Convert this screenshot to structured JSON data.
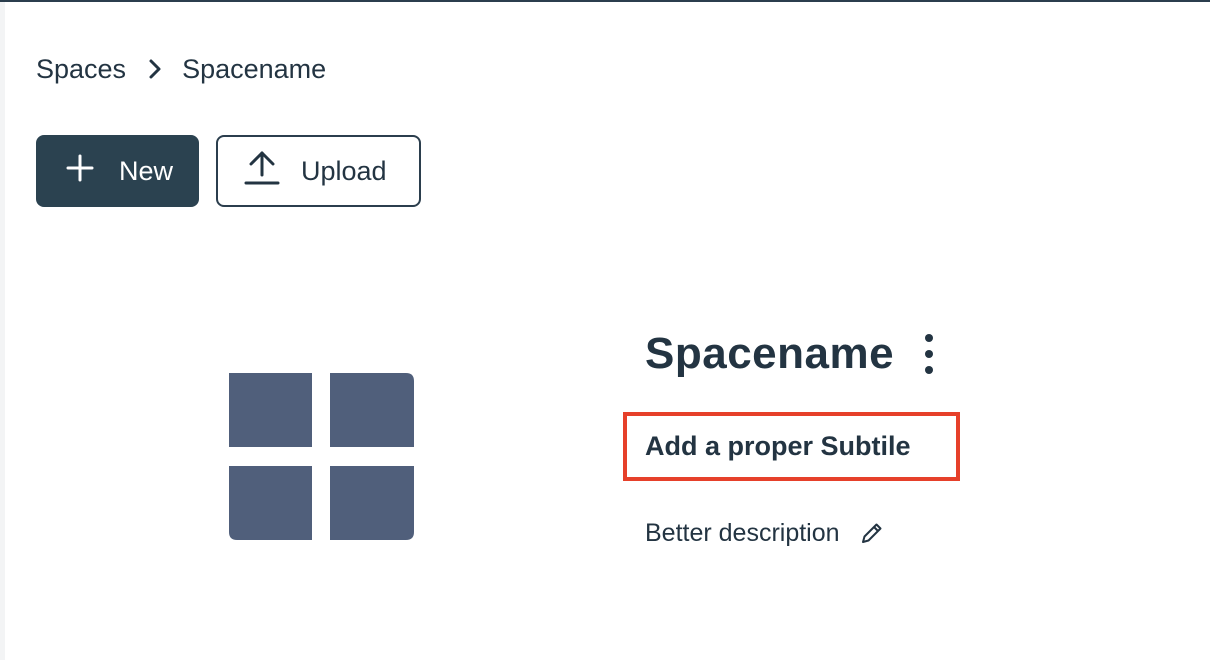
{
  "breadcrumb": {
    "items": [
      "Spaces",
      "Spacename"
    ],
    "separator_icon": "chevron-right-icon"
  },
  "toolbar": {
    "new_label": "New",
    "new_icon": "plus-icon",
    "upload_label": "Upload",
    "upload_icon": "upload-icon"
  },
  "space": {
    "icon": "space-grid-icon",
    "icon_color": "#505f7b",
    "title": "Spacename",
    "menu_icon": "kebab-menu-icon",
    "subtitle": "Add a proper Subtile",
    "description": "Better description",
    "edit_icon": "pencil-icon"
  },
  "colors": {
    "primary": "#2b4250",
    "text": "#233442",
    "highlight": "#e6402a"
  }
}
